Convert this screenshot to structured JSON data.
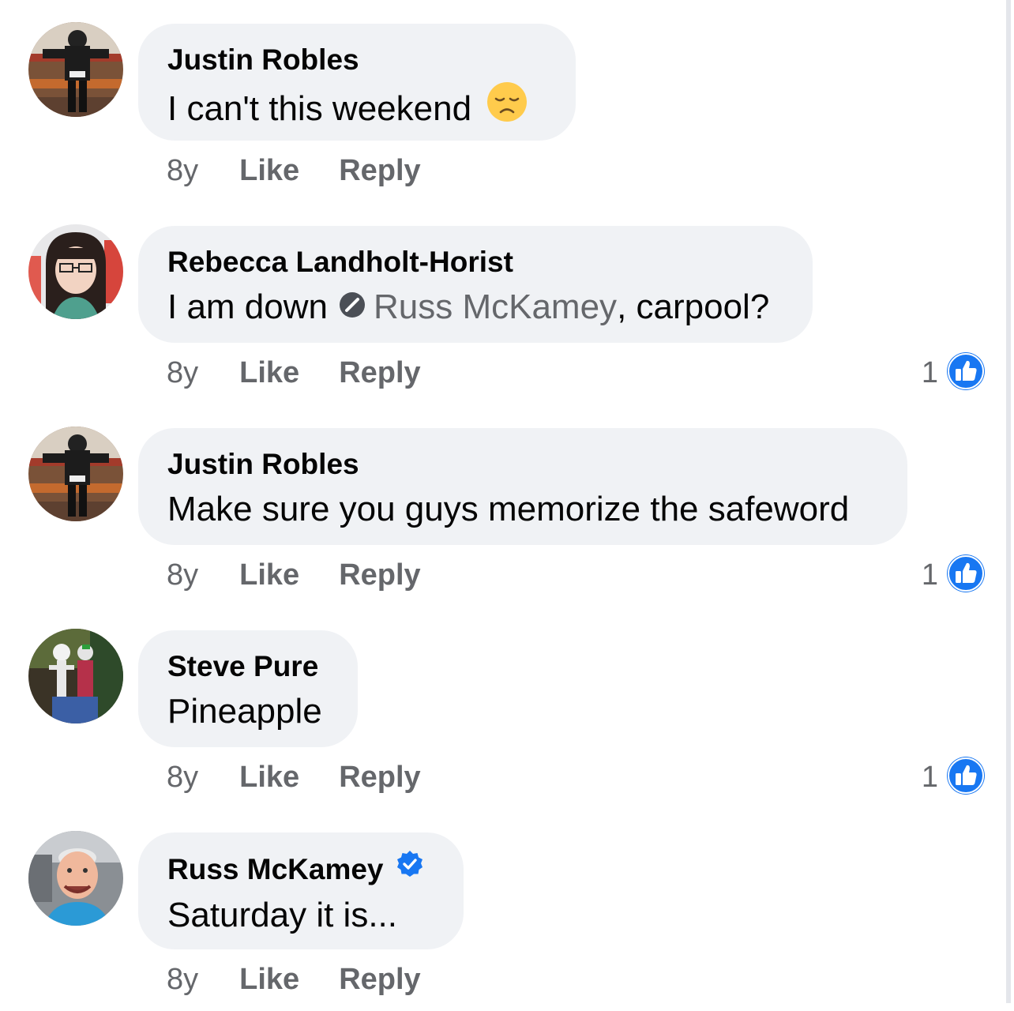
{
  "colors": {
    "bubble": "#f0f2f5",
    "meta_text": "#65676b",
    "like_blue": "#1877f2",
    "verified_blue": "#1877f2"
  },
  "comments": [
    {
      "author": "Justin Robles",
      "text": "I can't this weekend",
      "emoji": "disappointed-face-icon",
      "time": "8y",
      "like_label": "Like",
      "reply_label": "Reply",
      "reaction_count": ""
    },
    {
      "author": "Rebecca Landholt-Horist",
      "text_before": "I am down",
      "mention": "Russ McKamey",
      "text_after": ", carpool?",
      "time": "8y",
      "like_label": "Like",
      "reply_label": "Reply",
      "reaction_count": "1"
    },
    {
      "author": "Justin Robles",
      "text": "Make sure you guys memorize the safeword",
      "time": "8y",
      "like_label": "Like",
      "reply_label": "Reply",
      "reaction_count": "1"
    },
    {
      "author": "Steve Pure",
      "text": "Pineapple",
      "time": "8y",
      "like_label": "Like",
      "reply_label": "Reply",
      "reaction_count": "1"
    },
    {
      "author": "Russ McKamey",
      "verified": true,
      "text": "Saturday it is...",
      "time": "8y",
      "like_label": "Like",
      "reply_label": "Reply",
      "reaction_count": ""
    }
  ]
}
